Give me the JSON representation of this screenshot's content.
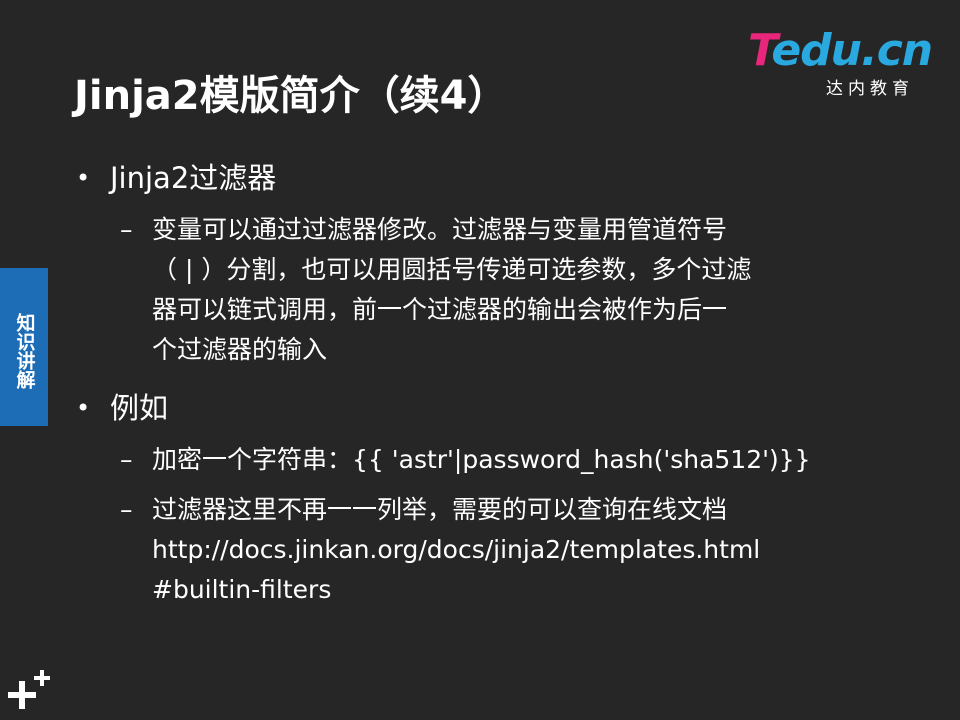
{
  "logo": {
    "brand_prefix": "T",
    "brand_rest": "edu.cn",
    "subtitle": "达内教育"
  },
  "title": "Jinja2模版简介（续4）",
  "side_tab": {
    "label": "知识讲解"
  },
  "bullets": [
    {
      "text": "Jinja2过滤器",
      "subs": [
        {
          "lines": [
            "变量可以通过过滤器修改。过滤器与变量用管道符号",
            "（ | ）分割，也可以用圆括号传递可选参数，多个过滤",
            "器可以链式调用，前一个过滤器的输出会被作为后一",
            "个过滤器的输入"
          ]
        }
      ]
    },
    {
      "text": "例如",
      "subs": [
        {
          "lines": [
            "加密一个字符串：{{ 'astr'|password_hash('sha512')}}"
          ]
        },
        {
          "lines": [
            "过滤器这里不再一一列举，需要的可以查询在线文档",
            "http://docs.jinkan.org/docs/jinja2/templates.html",
            "#builtin-filters"
          ]
        }
      ]
    }
  ],
  "bullet_symbol": "•",
  "dash_symbol": "–",
  "colors": {
    "background": "#262626",
    "side_tab": "#1c6cb6",
    "logo_pink": "#e8267c",
    "logo_blue": "#2aa9e0"
  },
  "icons": {
    "bottom_left": "plus-sparkle-icon"
  }
}
